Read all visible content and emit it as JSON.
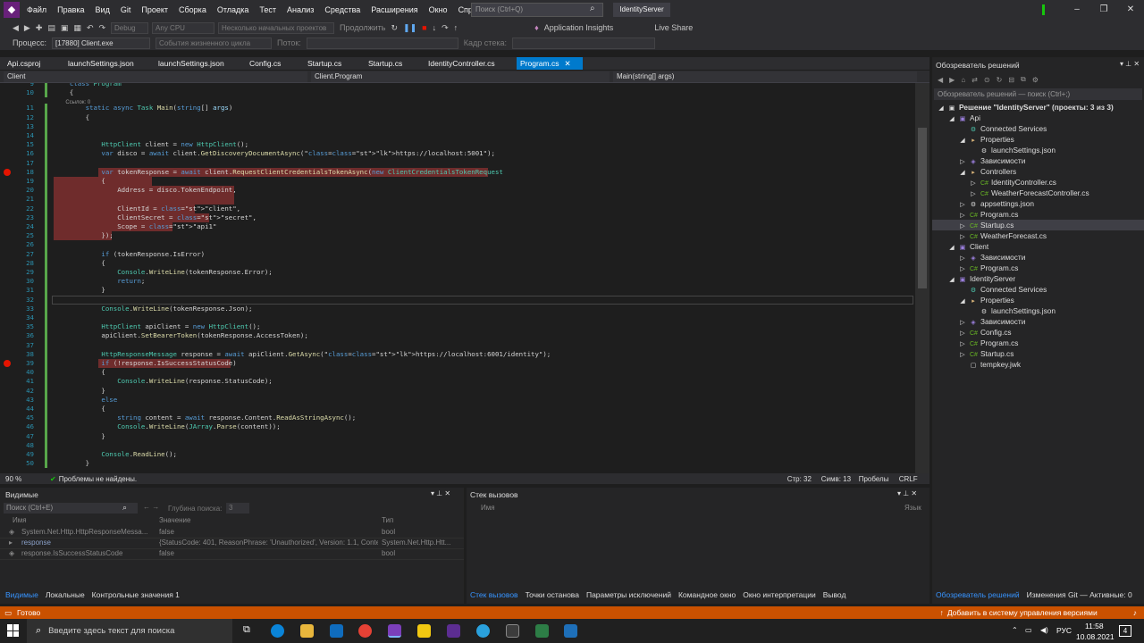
{
  "menu": [
    "Файл",
    "Правка",
    "Вид",
    "Git",
    "Проект",
    "Сборка",
    "Отладка",
    "Тест",
    "Анализ",
    "Средства",
    "Расширения",
    "Окно",
    "Справка"
  ],
  "search_placeholder": "Поиск (Ctrl+Q)",
  "solution_name": "IdentityServer",
  "toolbar": {
    "config": "Debug",
    "platform": "Any CPU",
    "startup": "Несколько начальных проектов",
    "continue": "Продолжить",
    "app_insights": "Application Insights",
    "live_share": "Live Share"
  },
  "procbar": {
    "process_label": "Процесс:",
    "process_value": "[17880] Client.exe",
    "lifecycle": "События жизненного цикла",
    "thread_label": "Поток:",
    "stack_label": "Кадр стека:"
  },
  "tabs": [
    "Api.csproj",
    "launchSettings.json",
    "launchSettings.json",
    "Config.cs",
    "Startup.cs",
    "Startup.cs",
    "IdentityController.cs",
    "Program.cs"
  ],
  "nav": {
    "project": "Client",
    "class": "Client.Program",
    "member": "Main(string[] args)"
  },
  "code_lines": [
    {
      "n": "9",
      "t": "    class Program"
    },
    {
      "n": "10",
      "t": "    {"
    },
    {
      "n": "",
      "t": "        Ссылок: 0"
    },
    {
      "n": "11",
      "t": "        static async Task Main(string[] args)"
    },
    {
      "n": "12",
      "t": "        {"
    },
    {
      "n": "13",
      "t": ""
    },
    {
      "n": "14",
      "t": ""
    },
    {
      "n": "15",
      "t": "            HttpClient client = new HttpClient();"
    },
    {
      "n": "16",
      "t": "            var disco = await client.GetDiscoveryDocumentAsync(\"https://localhost:5001\");"
    },
    {
      "n": "17",
      "t": ""
    },
    {
      "n": "18",
      "t": "            var tokenResponse = await client.RequestClientCredentialsTokenAsync(new ClientCredentialsTokenRequest"
    },
    {
      "n": "19",
      "t": "            {"
    },
    {
      "n": "20",
      "t": "                Address = disco.TokenEndpoint,"
    },
    {
      "n": "21",
      "t": ""
    },
    {
      "n": "22",
      "t": "                ClientId = \"client\","
    },
    {
      "n": "23",
      "t": "                ClientSecret = \"secret\","
    },
    {
      "n": "24",
      "t": "                Scope = \"api1\""
    },
    {
      "n": "25",
      "t": "            });"
    },
    {
      "n": "26",
      "t": ""
    },
    {
      "n": "27",
      "t": "            if (tokenResponse.IsError)"
    },
    {
      "n": "28",
      "t": "            {"
    },
    {
      "n": "29",
      "t": "                Console.WriteLine(tokenResponse.Error);"
    },
    {
      "n": "30",
      "t": "                return;"
    },
    {
      "n": "31",
      "t": "            }"
    },
    {
      "n": "32",
      "t": ""
    },
    {
      "n": "33",
      "t": "            Console.WriteLine(tokenResponse.Json);"
    },
    {
      "n": "34",
      "t": ""
    },
    {
      "n": "35",
      "t": "            HttpClient apiClient = new HttpClient();"
    },
    {
      "n": "36",
      "t": "            apiClient.SetBearerToken(tokenResponse.AccessToken);"
    },
    {
      "n": "37",
      "t": ""
    },
    {
      "n": "38",
      "t": "            HttpResponseMessage response = await apiClient.GetAsync(\"https://localhost:6001/identity\");"
    },
    {
      "n": "39",
      "t": "            if (!response.IsSuccessStatusCode)"
    },
    {
      "n": "40",
      "t": "            {"
    },
    {
      "n": "41",
      "t": "                Console.WriteLine(response.StatusCode);"
    },
    {
      "n": "42",
      "t": "            }"
    },
    {
      "n": "43",
      "t": "            else"
    },
    {
      "n": "44",
      "t": "            {"
    },
    {
      "n": "45",
      "t": "                string content = await response.Content.ReadAsStringAsync();"
    },
    {
      "n": "46",
      "t": "                Console.WriteLine(JArray.Parse(content));"
    },
    {
      "n": "47",
      "t": "            }"
    },
    {
      "n": "48",
      "t": ""
    },
    {
      "n": "49",
      "t": "            Console.ReadLine();"
    },
    {
      "n": "50",
      "t": "        }"
    }
  ],
  "editor_status": {
    "zoom": "90 %",
    "problems": "Проблемы не найдены.",
    "line": "Стр: 32",
    "col": "Симв: 13",
    "spaces": "Пробелы",
    "eol": "CRLF"
  },
  "solution_explorer": {
    "title": "Обозреватель решений",
    "search": "Обозреватель решений — поиск (Ctrl+;)",
    "items": [
      {
        "label": "Решение \"IdentityServer\" (проекты: 3 из 3)"
      },
      {
        "label": "Api"
      },
      {
        "label": "Connected Services"
      },
      {
        "label": "Properties"
      },
      {
        "label": "launchSettings.json"
      },
      {
        "label": "Зависимости"
      },
      {
        "label": "Controllers"
      },
      {
        "label": "IdentityController.cs"
      },
      {
        "label": "WeatherForecastController.cs"
      },
      {
        "label": "appsettings.json"
      },
      {
        "label": "Program.cs"
      },
      {
        "label": "Startup.cs"
      },
      {
        "label": "WeatherForecast.cs"
      },
      {
        "label": "Client"
      },
      {
        "label": "Зависимости"
      },
      {
        "label": "Program.cs"
      },
      {
        "label": "IdentityServer"
      },
      {
        "label": "Connected Services"
      },
      {
        "label": "Properties"
      },
      {
        "label": "launchSettings.json"
      },
      {
        "label": "Зависимости"
      },
      {
        "label": "Config.cs"
      },
      {
        "label": "Program.cs"
      },
      {
        "label": "Startup.cs"
      },
      {
        "label": "tempkey.jwk"
      }
    ],
    "tabs": [
      "Обозреватель решений",
      "Изменения Git — Активные: 0"
    ]
  },
  "watch": {
    "title": "Видимые",
    "search": "Поиск (Ctrl+E)",
    "depth_label": "Глубина поиска:",
    "depth_value": "3",
    "col_name": "Имя",
    "col_value": "Значение",
    "col_type": "Тип",
    "rows": [
      {
        "name": "System.Net.Http.HttpResponseMessa...",
        "value": "false",
        "type": "bool"
      },
      {
        "name": "response",
        "value": "{StatusCode: 401, ReasonPhrase: 'Unauthorized', Version: 1.1, Conte...",
        "type": "System.Net.Http.Htt..."
      },
      {
        "name": "response.IsSuccessStatusCode",
        "value": "false",
        "type": "bool"
      }
    ],
    "tabs": [
      "Видимые",
      "Локальные",
      "Контрольные значения 1"
    ]
  },
  "callstack": {
    "title": "Стек вызовов",
    "col_name": "Имя",
    "col_lang": "Язык",
    "tabs": [
      "Стек вызовов",
      "Точки останова",
      "Параметры исключений",
      "Командное окно",
      "Окно интерпретации",
      "Вывод"
    ]
  },
  "status": {
    "ready": "Готово",
    "vcs": "Добавить в систему управления версиями"
  },
  "taskbar": {
    "search": "Введите здесь текст для поиска",
    "lang": "РУС",
    "time": "11:58",
    "date": "10.08.2021",
    "notif": "4"
  }
}
